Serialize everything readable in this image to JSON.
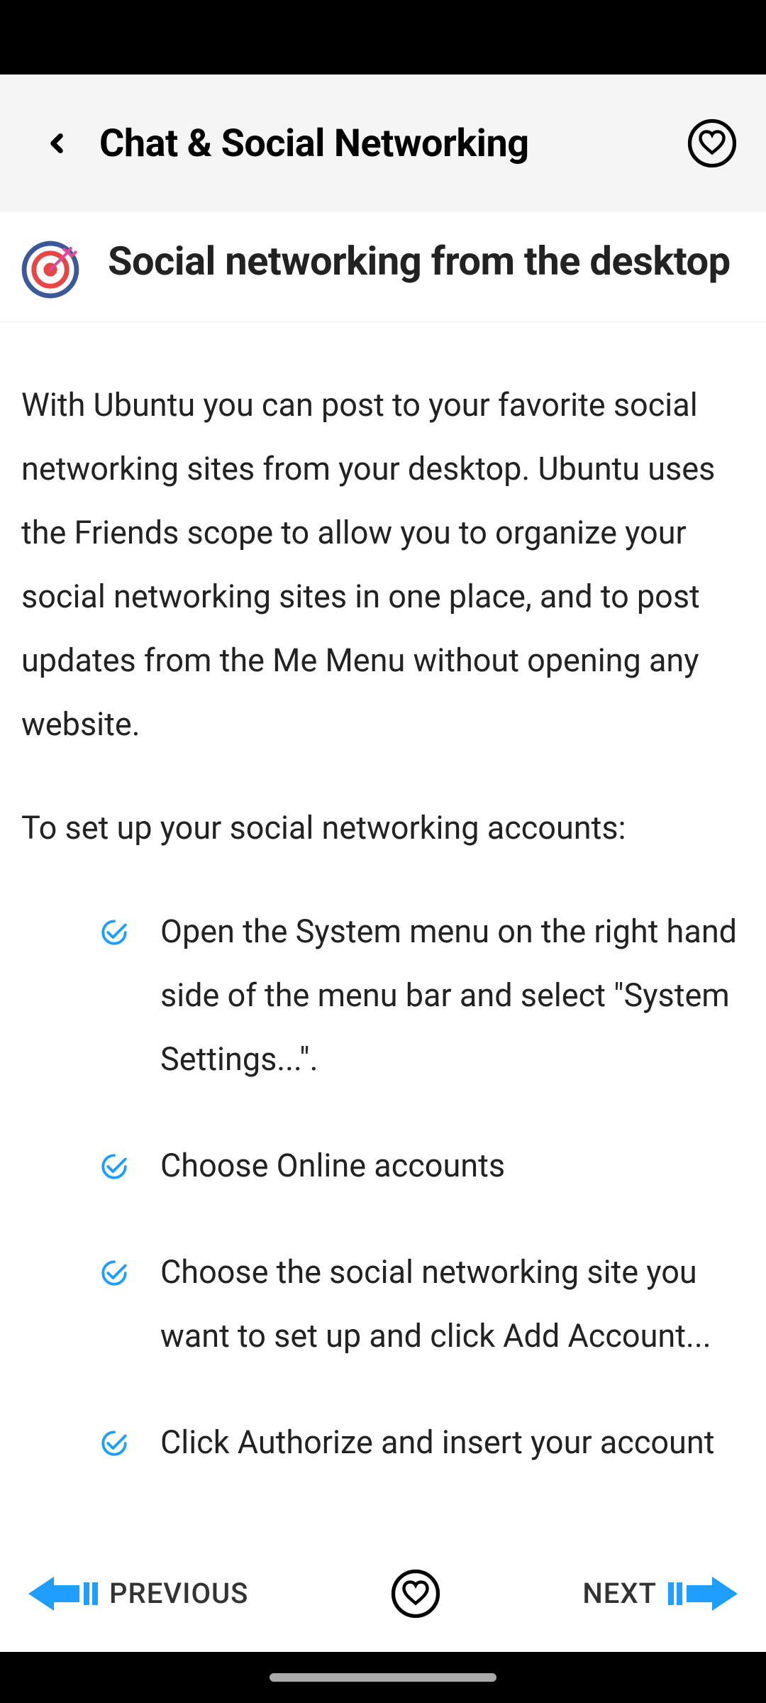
{
  "header": {
    "title": "Chat & Social Networking"
  },
  "section": {
    "title": "Social networking from the desktop",
    "para1": "With Ubuntu you can post to your favorite social networking sites from your desktop. Ubuntu uses the Friends scope to allow you to organize your social networking sites in one place, and to post updates from the Me Menu without opening any website.",
    "para2": "To set up your social networking accounts:",
    "steps": [
      "Open the System menu on the right hand side of the menu bar and select \"System Settings...\".",
      "Choose Online accounts",
      "Choose the social networking site you want to set up and click Add Account...",
      "Click Authorize and insert your account"
    ]
  },
  "footer": {
    "prev": "PREVIOUS",
    "next": "NEXT"
  },
  "colors": {
    "accent": "#1e9fff",
    "check": "#1e9fff",
    "target_pink": "#de4a9e",
    "target_red": "#e84545"
  }
}
